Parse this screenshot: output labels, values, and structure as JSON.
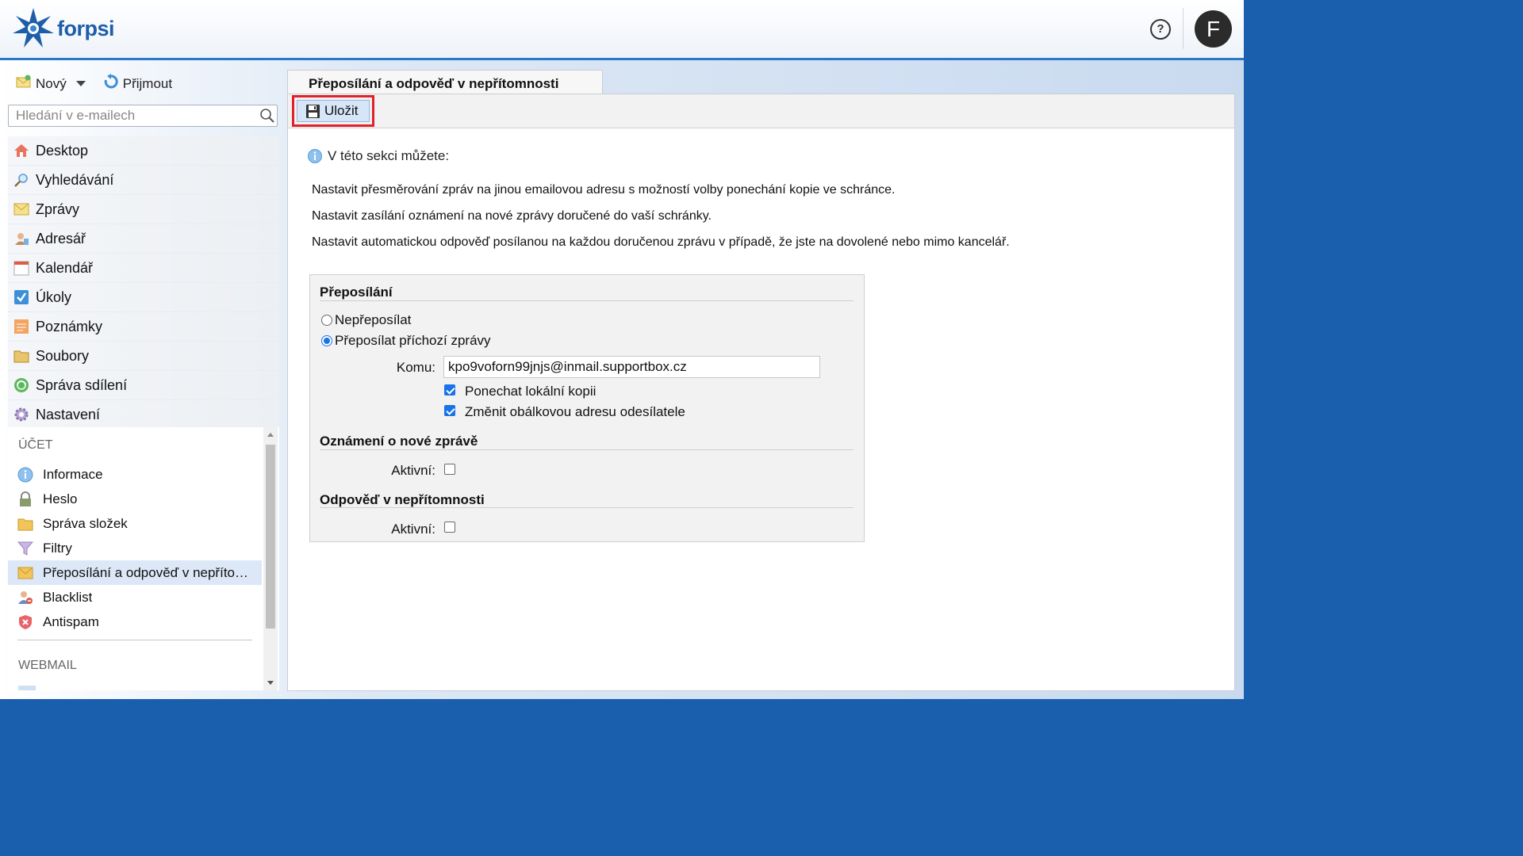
{
  "header": {
    "logo_text": "forpsi",
    "help_label": "?",
    "avatar_initial": "F"
  },
  "sidebar": {
    "new_label": "Nový",
    "receive_label": "Přijmout",
    "search_placeholder": "Hledání v e-mailech",
    "nav": [
      {
        "label": "Desktop",
        "icon": "home-icon"
      },
      {
        "label": "Vyhledávání",
        "icon": "search-icon"
      },
      {
        "label": "Zprávy",
        "icon": "envelope-icon"
      },
      {
        "label": "Adresář",
        "icon": "contacts-icon"
      },
      {
        "label": "Kalendář",
        "icon": "calendar-icon"
      },
      {
        "label": "Úkoly",
        "icon": "tasks-icon"
      },
      {
        "label": "Poznámky",
        "icon": "notes-icon"
      },
      {
        "label": "Soubory",
        "icon": "folder-icon"
      },
      {
        "label": "Správa sdílení",
        "icon": "share-icon"
      },
      {
        "label": "Nastavení",
        "icon": "gear-icon"
      }
    ],
    "account_section_title": "ÚČET",
    "account_items": [
      {
        "label": "Informace",
        "icon": "info-icon"
      },
      {
        "label": "Heslo",
        "icon": "lock-icon"
      },
      {
        "label": "Správa složek",
        "icon": "folder-icon"
      },
      {
        "label": "Filtry",
        "icon": "filter-icon"
      },
      {
        "label": "Přeposílání a odpověď v nepřítomnosti",
        "icon": "forward-mail-icon"
      },
      {
        "label": "Blacklist",
        "icon": "blacklist-icon"
      },
      {
        "label": "Antispam",
        "icon": "shield-icon"
      }
    ],
    "webmail_section_title": "WEBMAIL"
  },
  "main": {
    "tab_label": "Přeposílání a odpověď v nepřítomnosti",
    "save_label": "Uložit",
    "intro": "V této sekci můžete:",
    "lines": [
      "Nastavit přesměrování zpráv na jinou emailovou adresu s možností volby ponechání kopie ve schránce.",
      "Nastavit zasílání oznámení na nové zprávy doručené do vaší schránky.",
      "Nastavit automatickou odpověď posílanou na každou doručenou zprávu v případě, že jste na dovolené nebo mimo kancelář."
    ],
    "forwarding": {
      "title": "Přeposílání",
      "option_off": "Nepřeposílat",
      "option_on": "Přeposílat příchozí zprávy",
      "to_label": "Komu:",
      "to_value": "kpo9voforn99jnjs@inmail.supportbox.cz",
      "keep_copy_label": "Ponechat lokální kopii",
      "change_envelope_label": "Změnit obálkovou adresu odesílatele"
    },
    "notification": {
      "title": "Oznámení o nové zprávě",
      "active_label": "Aktivní:"
    },
    "autoreply": {
      "title": "Odpověď v nepřítomnosti",
      "active_label": "Aktivní:"
    }
  },
  "colors": {
    "accent": "#1a73e8",
    "brand": "#1e5ea8",
    "highlight_border": "#e0202a",
    "active_row": "#dce8f7"
  }
}
